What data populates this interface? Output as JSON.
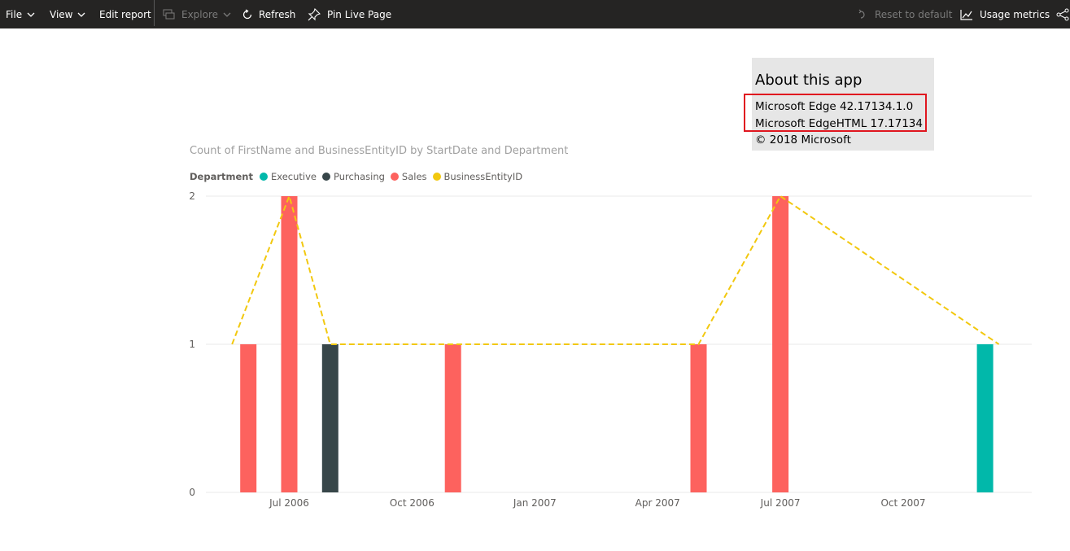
{
  "toolbar": {
    "file_label": "File",
    "view_label": "View",
    "edit_report_label": "Edit report",
    "explore_label": "Explore",
    "refresh_label": "Refresh",
    "pin_label": "Pin Live Page",
    "reset_label": "Reset to default",
    "usage_label": "Usage metrics"
  },
  "about": {
    "title": "About this app",
    "line1": "Microsoft Edge 42.17134.1.0",
    "line2": "Microsoft EdgeHTML 17.17134",
    "line3": "© 2018 Microsoft"
  },
  "colors": {
    "executive": "#01b8aa",
    "purchasing": "#374649",
    "sales": "#fd625e",
    "businessentityid": "#f2c80f",
    "highlight": "#e0161f"
  },
  "chart_data": {
    "type": "bar",
    "title": "Count of FirstName and BusinessEntityID by StartDate and Department",
    "legend_title": "Department",
    "legend_position": "top-left",
    "x_tick_labels": [
      "Jul 2006",
      "Oct 2006",
      "Jan 2007",
      "Apr 2007",
      "Jul 2007",
      "Oct 2007"
    ],
    "y_ticks": [
      0,
      1,
      2
    ],
    "ylim": [
      0,
      2
    ],
    "grid": true,
    "bars": [
      {
        "date": "2006-06",
        "series": "Sales",
        "value": 1
      },
      {
        "date": "2006-07",
        "series": "Sales",
        "value": 2
      },
      {
        "date": "2006-08",
        "series": "Purchasing",
        "value": 1
      },
      {
        "date": "2006-11",
        "series": "Sales",
        "value": 1
      },
      {
        "date": "2007-05",
        "series": "Sales",
        "value": 1
      },
      {
        "date": "2007-07",
        "series": "Sales",
        "value": 2
      },
      {
        "date": "2007-12",
        "series": "Executive",
        "value": 1
      }
    ],
    "line": {
      "series": "BusinessEntityID",
      "style": "dashed",
      "points": [
        {
          "date": "2006-06",
          "value": 1
        },
        {
          "date": "2006-07",
          "value": 2
        },
        {
          "date": "2006-08",
          "value": 1
        },
        {
          "date": "2006-11",
          "value": 1
        },
        {
          "date": "2007-05",
          "value": 1
        },
        {
          "date": "2007-07",
          "value": 2
        },
        {
          "date": "2007-12",
          "value": 1
        }
      ]
    },
    "series": [
      {
        "name": "Executive",
        "color": "#01b8aa"
      },
      {
        "name": "Purchasing",
        "color": "#374649"
      },
      {
        "name": "Sales",
        "color": "#fd625e"
      },
      {
        "name": "BusinessEntityID",
        "color": "#f2c80f"
      }
    ]
  }
}
